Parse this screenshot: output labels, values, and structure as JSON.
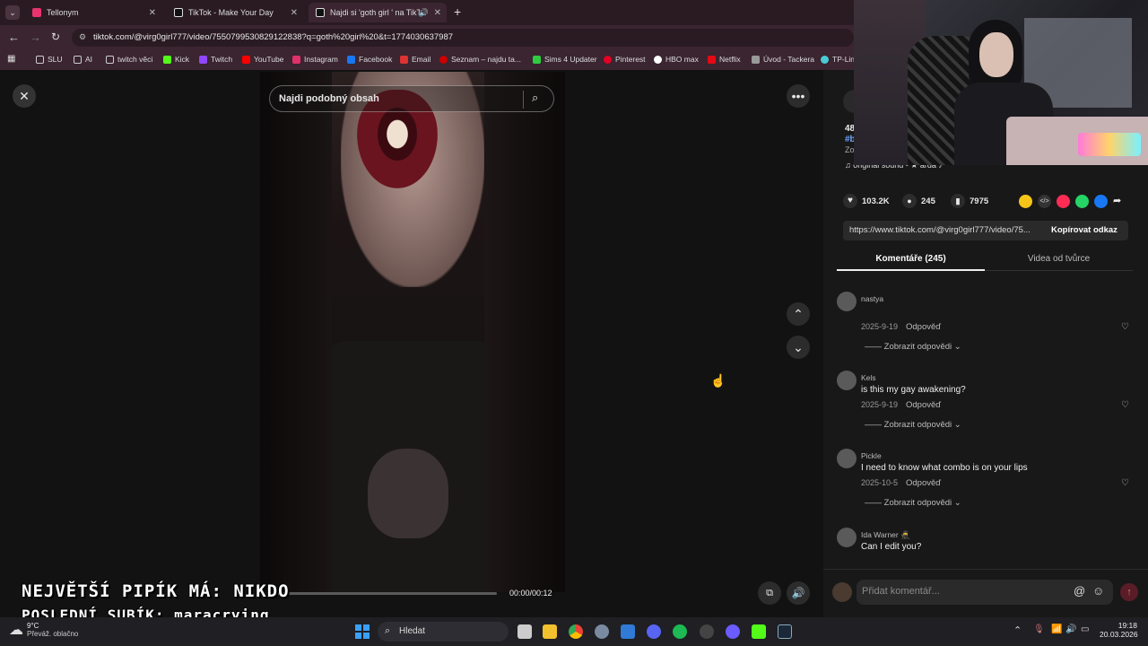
{
  "tabs": [
    {
      "label": "Tellonym",
      "color": "#e8336e"
    },
    {
      "label": "TikTok - Make Your Day",
      "color": "#ffffff"
    },
    {
      "label": "Najdi si 'goth girl ' na TikTo",
      "color": "#ffffff"
    }
  ],
  "address": {
    "url": "tiktok.com/@virg0girl777/video/7550799530829122838?q=goth%20girl%20&t=1774030637987"
  },
  "bookmarks": [
    "SLU",
    "AI",
    "twitch věci",
    "Kick",
    "Twitch",
    "YouTube",
    "Instagram",
    "Facebook",
    "Email",
    "Seznam – najdu ta...",
    "Sims 4 Updater",
    "Pinterest",
    "HBO max",
    "Netflix",
    "Úvod - Tackera",
    "TP-Link"
  ],
  "video": {
    "search_placeholder": "Najdi podobný obsah",
    "time": "00:00/00:12",
    "progress": 0.02
  },
  "overlay": {
    "line1": "NEJVĚTŠÍ PIPÍK MÁ: NIKDO",
    "line2": "POSLEDNÍ SUBÍK: maracrying"
  },
  "panel": {
    "header_lines": [
      "48",
      "#b",
      "Zo"
    ],
    "sound": "original sound - ★ arda ♪",
    "likes": "103.2K",
    "comments": "245",
    "saves": "7975",
    "link": "https://www.tiktok.com/@virg0girl777/video/75...",
    "copy_label": "Kopírovat odkaz",
    "tab_comments": "Komentáře (245)",
    "tab_creator": "Videa od tvůrce",
    "comment_list": [
      {
        "name": "nastya",
        "text": "",
        "date": "2025-9-19",
        "reply": "Odpověď",
        "show": "Zobrazit odpovědi"
      },
      {
        "name": "Kels",
        "text": "is this my gay awakening?",
        "date": "2025-9-19",
        "reply": "Odpověď",
        "show": "Zobrazit odpovědi"
      },
      {
        "name": "Pickle",
        "text": "I need to know what combo is on your lips",
        "date": "2025-10-5",
        "reply": "Odpověď",
        "show": "Zobrazit odpovědi"
      },
      {
        "name": "Ida Warner 🥷",
        "text": "Can I edit you?",
        "date": "",
        "reply": "",
        "show": ""
      }
    ],
    "add_comment_placeholder": "Přidat komentář..."
  },
  "taskbar": {
    "weather_temp": "9°C",
    "weather_desc": "Převáž. oblačno",
    "search_label": "Hledat",
    "clock_time": "19:18",
    "clock_date": "20.03.2026"
  },
  "colors": {
    "accent": "#fe2c55",
    "tab_bg": "#2a1b22",
    "toolbar_bg": "#3a2530"
  }
}
